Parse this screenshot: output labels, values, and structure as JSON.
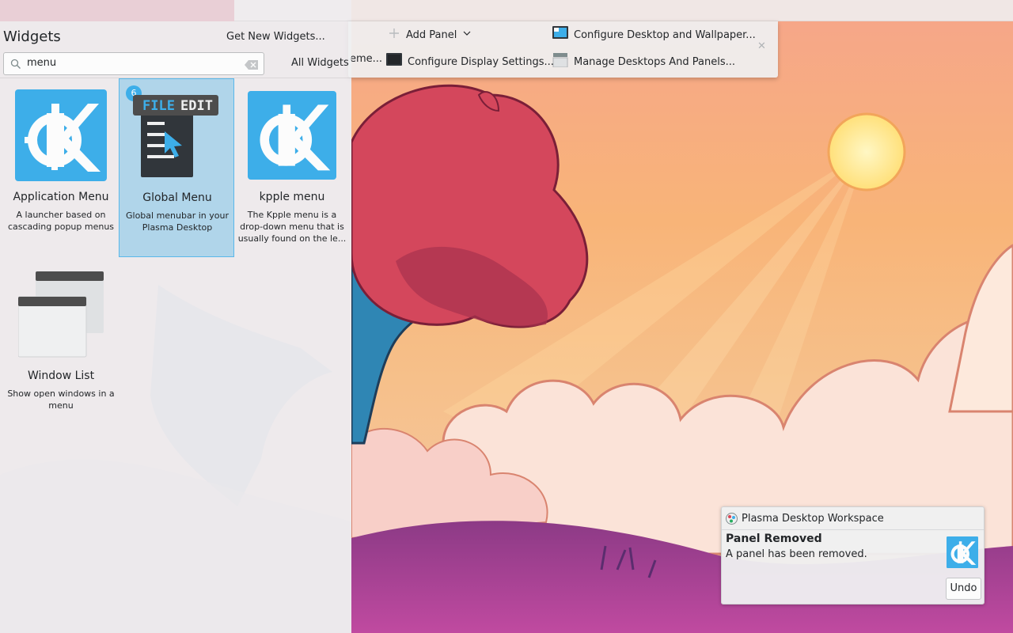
{
  "toolbar": {
    "add_panel_label": "Add Panel",
    "configure_desktop_label": "Configure Desktop and Wallpaper...",
    "theme_partial_label": "eme...",
    "configure_display_label": "Configure Display Settings...",
    "manage_desktops_label": "Manage Desktops And Panels..."
  },
  "explorer": {
    "title": "Widgets",
    "get_new_label": "Get New Widgets...",
    "search_value": "menu",
    "filter_label": "All Widgets",
    "widgets": [
      {
        "name": "Application Menu",
        "desc": "A launcher based on cascading popup menus",
        "icon": "kde-logo-icon"
      },
      {
        "name": "Global Menu",
        "desc": "Global menubar in your Plasma Desktop",
        "icon": "global-menu-icon",
        "badge": "6",
        "selected": true,
        "icon_text_file": "FILE",
        "icon_text_edit": "EDIT"
      },
      {
        "name": "kpple menu",
        "desc": "The Kpple menu is a drop-down menu that is usually found on the le...",
        "icon": "kde-logo-icon"
      },
      {
        "name": "Window List",
        "desc": "Show open windows in a menu",
        "icon": "window-list-icon"
      }
    ]
  },
  "notification": {
    "app_name": "Plasma Desktop Workspace",
    "title": "Panel Removed",
    "body": "A panel has been removed.",
    "undo_label": "Undo"
  },
  "colors": {
    "accent": "#3daee9",
    "panel_bg": "#eff0f1",
    "text": "#232629"
  }
}
